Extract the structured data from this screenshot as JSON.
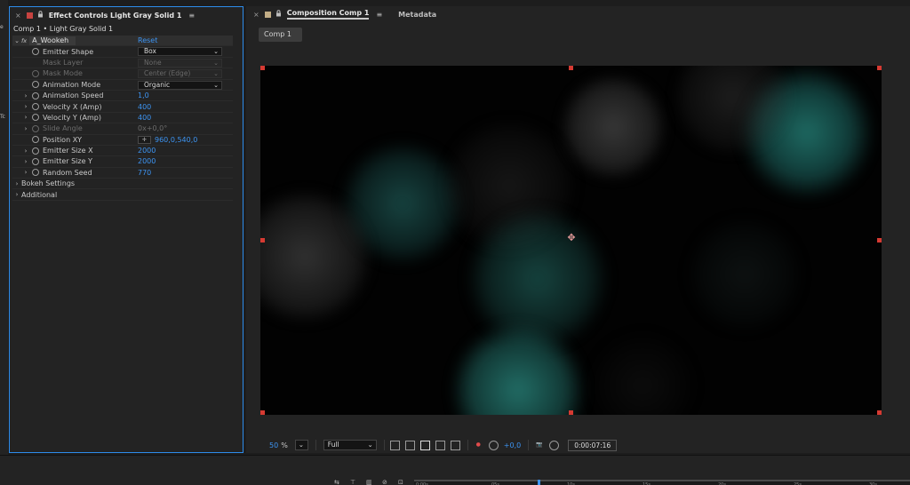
{
  "left_edge": {
    "glyph_e": "e",
    "glyph_t": "Tc"
  },
  "effect_controls": {
    "close": "×",
    "label_color": "#c74340",
    "lock_icon": "lock-icon",
    "title": "Effect Controls Light Gray Solid 1",
    "menu_glyph": "≡",
    "subtitle": "Comp 1 • Light Gray Solid 1",
    "effect": {
      "fx": "fx",
      "name": "A_Wookeh",
      "reset": "Reset"
    },
    "rows": [
      {
        "label": "Emitter Shape",
        "type": "dropdown",
        "value": "Box",
        "enabled": true
      },
      {
        "label": "Mask Layer",
        "type": "dropdown",
        "value": "None",
        "enabled": false
      },
      {
        "label": "Mask Mode",
        "type": "dropdown",
        "value": "Center (Edge)",
        "enabled": false
      },
      {
        "label": "Animation Mode",
        "type": "dropdown",
        "value": "Organic",
        "enabled": true
      },
      {
        "label": "Animation Speed",
        "type": "value",
        "value": "1,0",
        "enabled": true
      },
      {
        "label": "Velocity X (Amp)",
        "type": "value",
        "value": "400",
        "enabled": true
      },
      {
        "label": "Velocity Y (Amp)",
        "type": "value",
        "value": "400",
        "enabled": true
      },
      {
        "label": "Slide Angle",
        "type": "value",
        "value": "0x+0,0°",
        "enabled": false
      },
      {
        "label": "Position XY",
        "type": "point",
        "value": "960,0,540,0",
        "enabled": true
      },
      {
        "label": "Emitter Size X",
        "type": "value",
        "value": "2000",
        "enabled": true
      },
      {
        "label": "Emitter Size Y",
        "type": "value",
        "value": "2000",
        "enabled": true
      },
      {
        "label": "Random Seed",
        "type": "value",
        "value": "770",
        "enabled": true
      },
      {
        "label": "Bokeh Settings",
        "type": "group"
      },
      {
        "label": "Additional",
        "type": "group"
      }
    ]
  },
  "composition": {
    "close": "×",
    "label_color": "#c2ad86",
    "title": "Composition Comp 1",
    "menu_glyph": "≡",
    "metadata_tab": "Metadata",
    "breadcrumb": "Comp 1",
    "anchor_glyph": "✥",
    "toolbar": {
      "zoom_value": "50",
      "zoom_unit": "%",
      "resolution": "Full",
      "exposure": "+0,0",
      "timecode": "0:00:07:16"
    }
  },
  "timeline": {
    "ticks": [
      "0:00s",
      "05s",
      "10s",
      "15s",
      "20s",
      "25s",
      "30s"
    ]
  }
}
